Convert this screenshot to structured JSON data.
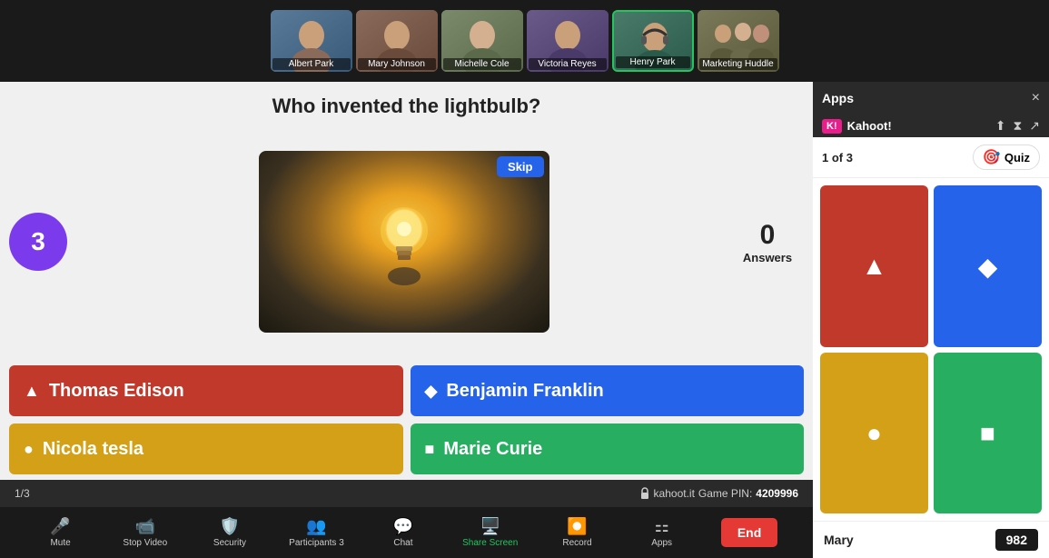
{
  "app": {
    "title": "Apps",
    "close_label": "×"
  },
  "participants": [
    {
      "name": "Albert Park",
      "class": "thumb-albert"
    },
    {
      "name": "Mary Johnson",
      "class": "thumb-mary"
    },
    {
      "name": "Michelle Cole",
      "class": "thumb-michelle"
    },
    {
      "name": "Victoria Reyes",
      "class": "thumb-victoria"
    },
    {
      "name": "Henry Park",
      "class": "thumb-henry",
      "active": true
    },
    {
      "name": "Marketing Huddle",
      "class": "thumb-marketing"
    }
  ],
  "question": {
    "text": "Who invented the lightbulb?",
    "timer": "3",
    "answers_count": "0",
    "answers_label": "Answers",
    "skip_label": "Skip"
  },
  "choices": [
    {
      "label": "Thomas Edison",
      "color": "choice-red",
      "icon": "▲"
    },
    {
      "label": "Benjamin Franklin",
      "color": "choice-blue",
      "icon": "◆"
    },
    {
      "label": "Nicola tesla",
      "color": "choice-yellow",
      "icon": "●"
    },
    {
      "label": "Marie Curie",
      "color": "choice-green",
      "icon": "■"
    }
  ],
  "status_bar": {
    "progress": "1/3",
    "site": "kahoot.it",
    "pin_prefix": "Game PIN:",
    "pin": "4209996"
  },
  "toolbar": {
    "mute_label": "Mute",
    "video_label": "Stop Video",
    "security_label": "Security",
    "participants_label": "Participants",
    "participants_count": "3",
    "chat_label": "Chat",
    "share_label": "Share Screen",
    "record_label": "Record",
    "apps_label": "Apps",
    "end_label": "End"
  },
  "right_panel": {
    "app_title": "Apps",
    "kahoot_name": "Kahoot!",
    "progress": "1 of 3",
    "quiz_label": "Quiz",
    "cells": [
      {
        "color": "kc-red",
        "symbol": "▲"
      },
      {
        "color": "kc-blue",
        "symbol": "◆"
      },
      {
        "color": "kc-yellow",
        "symbol": "●"
      },
      {
        "color": "kc-green",
        "symbol": "■"
      }
    ],
    "user_name": "Mary",
    "user_score": "982"
  }
}
